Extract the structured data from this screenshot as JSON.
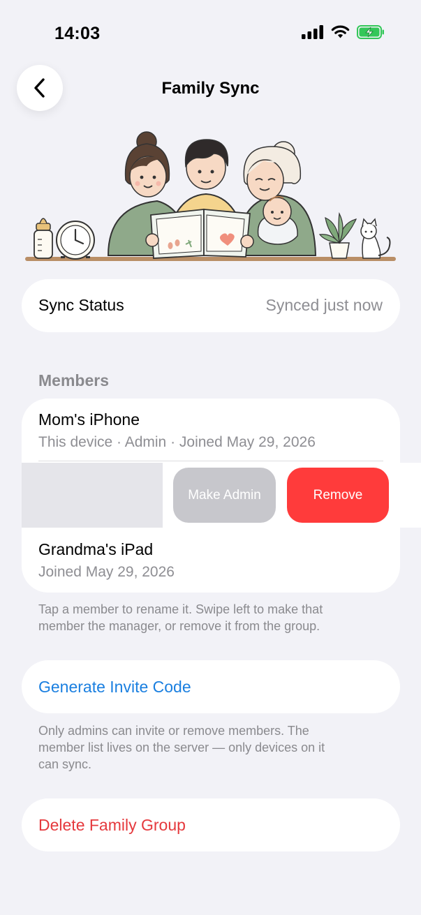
{
  "status_bar": {
    "time": "14:03"
  },
  "nav": {
    "title": "Family Sync",
    "back_icon": "chevron-left-icon"
  },
  "illustration": {
    "subject": "family-reading-book-illustration"
  },
  "sync": {
    "label": "Sync Status",
    "value": "Synced just now"
  },
  "members": {
    "header": "Members",
    "items": [
      {
        "name": "Mom's iPhone",
        "subtitle": "This device · Admin · Joined May 29, 2026"
      },
      {
        "name": "Grandma's iPad",
        "subtitle": "Joined May 29, 2026"
      }
    ],
    "swipe_actions": {
      "make_admin": "Make Admin",
      "remove": "Remove"
    },
    "footnote_line1": "Tap a member to rename it. Swipe left to make that",
    "footnote_line2": "member the manager, or remove it from the group."
  },
  "invite": {
    "label": "Generate Invite Code",
    "note_line1": "Only admins can invite or remove members. The",
    "note_line2": "member list lives on the server — only devices on it",
    "note_line3": "can sync."
  },
  "danger": {
    "label": "Delete Family Group"
  },
  "colors": {
    "accent": "#1a7fe0",
    "destructive": "#e5393d",
    "background": "#f2f2f7",
    "remove": "#ff3b3b",
    "make_admin": "#c7c7cc"
  }
}
